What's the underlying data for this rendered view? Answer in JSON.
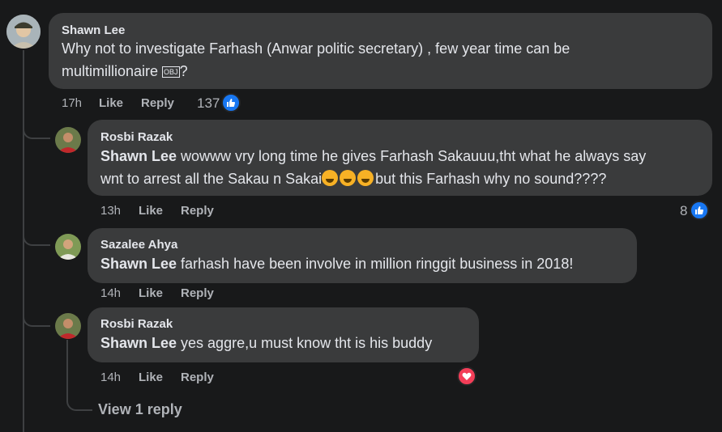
{
  "comments": [
    {
      "author": "Shawn Lee",
      "text_line1": "Why not to investigate Farhash (Anwar politic secretary) , few year time can be",
      "text_line2": "multimillionaire",
      "obj_char": "OBJ",
      "text_tail": "?",
      "time": "17h",
      "like": "Like",
      "reply": "Reply",
      "reactions": "137",
      "reaction_type": "like"
    }
  ],
  "replies": [
    {
      "author": "Rosbi Razak",
      "mention": "Shawn Lee",
      "text_line1": " wowww vry long time he gives Farhash Sakauuu,tht what he always say",
      "text_line2a": "wnt to arrest all the Sakau n Sakai",
      "text_line2b": "but this Farhash why no sound????",
      "emoji_icon": "rofl-emoji",
      "time": "13h",
      "like": "Like",
      "reply": "Reply",
      "reactions": "8",
      "reaction_type": "like"
    },
    {
      "author": "Sazalee Ahya",
      "mention": "Shawn Lee",
      "text": " farhash have been involve in million ringgit business in 2018!",
      "time": "14h",
      "like": "Like",
      "reply": "Reply"
    },
    {
      "author": "Rosbi Razak",
      "mention": "Shawn Lee",
      "text": " yes aggre,u must know tht is his buddy",
      "time": "14h",
      "like": "Like",
      "reply": "Reply",
      "reaction_type": "love"
    }
  ],
  "view_replies": "View 1 reply",
  "colors": {
    "background": "#18191a",
    "bubble": "#3a3b3c",
    "like_blue": "#1877f2",
    "love_red": "#f33e58"
  }
}
